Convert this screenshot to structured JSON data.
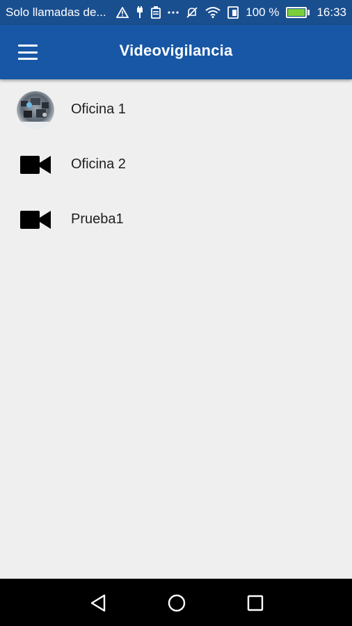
{
  "status_bar": {
    "carrier": "Solo llamadas de...",
    "battery_percent": "100 %",
    "time": "16:33",
    "icons": [
      "warning-icon",
      "usb-icon",
      "notification-icon",
      "more-icon",
      "mute-icon",
      "wifi-icon",
      "data-saver-icon",
      "battery-icon"
    ]
  },
  "app_bar": {
    "title": "Videovigilancia",
    "menu_icon": "hamburger-menu-icon",
    "background": "#1757a6"
  },
  "cameras": [
    {
      "label": "Oficina 1",
      "icon": "camera-thumbnail"
    },
    {
      "label": "Oficina 2",
      "icon": "videocam-icon"
    },
    {
      "label": "Prueba1",
      "icon": "videocam-icon"
    }
  ],
  "nav_bar": {
    "buttons": [
      "back-icon",
      "home-icon",
      "recents-icon"
    ]
  }
}
